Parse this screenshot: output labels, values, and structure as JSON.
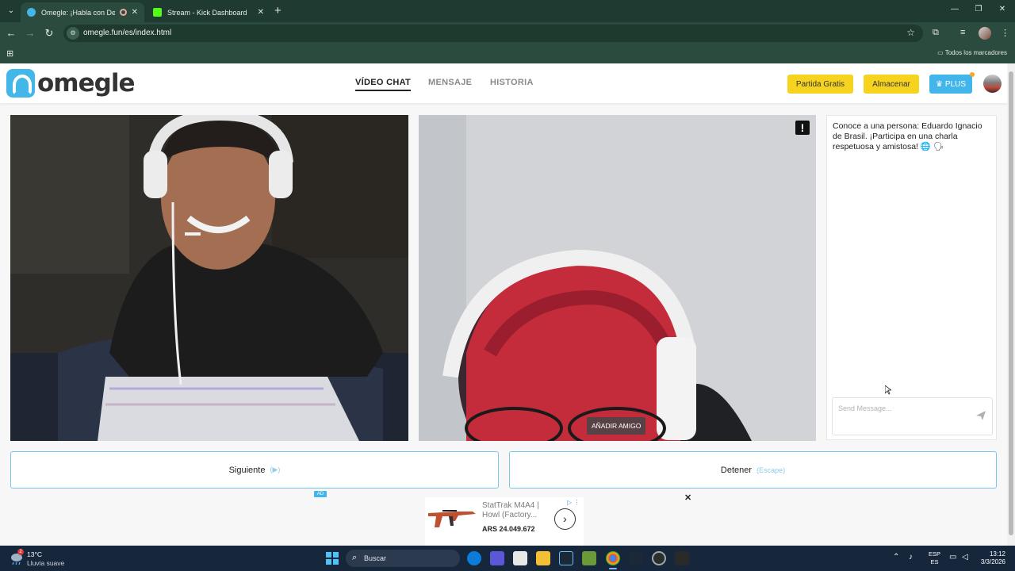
{
  "browser": {
    "tabs": [
      {
        "title": "Omegle: ¡Habla con Descon",
        "active": true
      },
      {
        "title": "Stream - Kick Dashboard",
        "active": false
      }
    ],
    "url": "omegle.fun/es/index.html",
    "bookmarks_label": "Todos los marcadores"
  },
  "site": {
    "logo_text": "omegle",
    "nav": [
      {
        "label": "VÍDEO CHAT",
        "active": true
      },
      {
        "label": "MENSAJE",
        "active": false
      },
      {
        "label": "HISTORIA",
        "active": false
      }
    ],
    "buttons": {
      "free_match": "Partida Gratis",
      "store": "Almacenar",
      "plus": "PLUS"
    },
    "colors": {
      "accent_blue": "#42b6ea",
      "button_yellow": "#f5d31f"
    }
  },
  "video": {
    "report_icon": "!",
    "add_friend": "AÑADIR AMIGO"
  },
  "chat": {
    "message": "Conoce a una persona: Eduardo Ignacio de Brasil. ¡Participa en una charla respetuosa y amistosa! 🌐 🗣",
    "placeholder": "Send Message..."
  },
  "actions": {
    "next_label": "Siguiente",
    "next_hint": "(▶)",
    "stop_label": "Detener",
    "stop_hint": "(Escape)"
  },
  "ad": {
    "tag": "AD",
    "close": "✕",
    "title": "StatTrak M4A4 | Howl (Factory...",
    "price": "ARS 24.049.672",
    "arrow": "›",
    "choice": "▷ ⋮"
  },
  "taskbar": {
    "temp": "13°C",
    "weather": "Lluvia suave",
    "weather_badge": "2",
    "search": "Buscar",
    "lang_top": "ESP",
    "lang_bottom": "ES",
    "time": "13:12",
    "date": "3/3/2026"
  }
}
